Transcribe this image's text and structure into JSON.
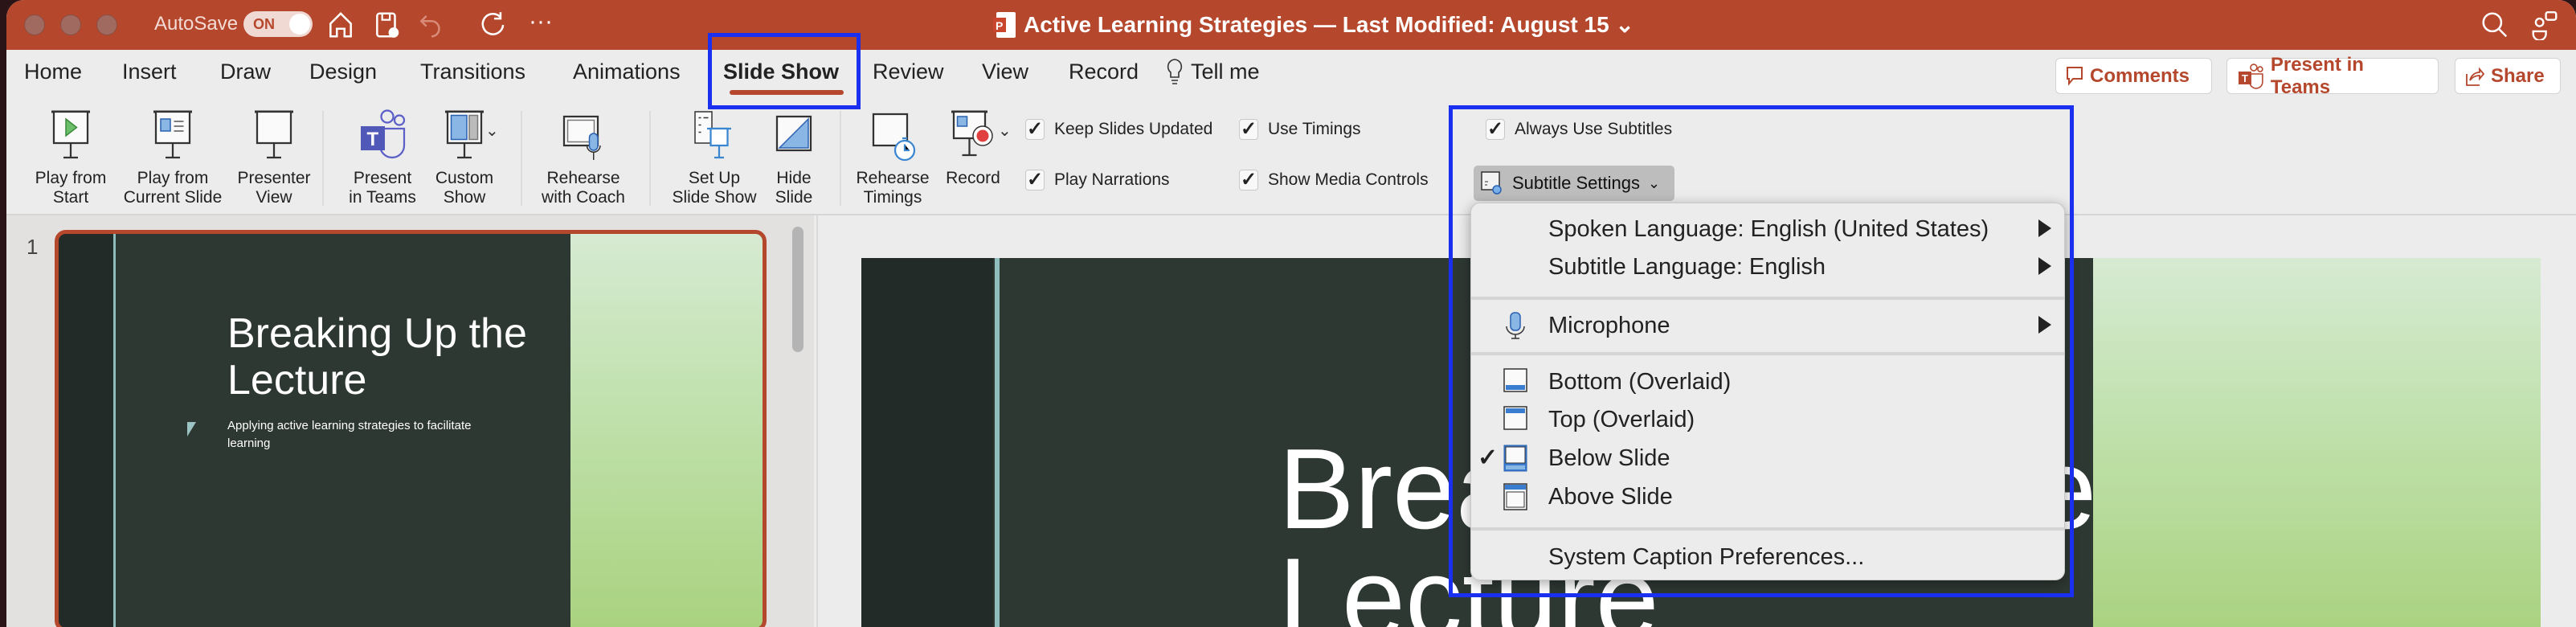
{
  "window": {
    "title": "Active Learning Strategies — Last Modified: August 15",
    "autosave_label": "AutoSave",
    "autosave_state": "ON"
  },
  "tabs": [
    {
      "label": "Home"
    },
    {
      "label": "Insert"
    },
    {
      "label": "Draw"
    },
    {
      "label": "Design"
    },
    {
      "label": "Transitions"
    },
    {
      "label": "Animations"
    },
    {
      "label": "Slide Show",
      "active": true
    },
    {
      "label": "Review"
    },
    {
      "label": "View"
    },
    {
      "label": "Record"
    },
    {
      "label": "Tell me"
    }
  ],
  "header_buttons": {
    "comments": "Comments",
    "present_teams": "Present in Teams",
    "share": "Share"
  },
  "ribbon": {
    "play_start": [
      "Play from",
      "Start"
    ],
    "play_current": [
      "Play from",
      "Current Slide"
    ],
    "presenter": [
      "Presenter",
      "View"
    ],
    "present_teams": [
      "Present",
      "in Teams"
    ],
    "custom_show": [
      "Custom",
      "Show"
    ],
    "rehearse_coach": [
      "Rehearse",
      "with Coach"
    ],
    "setup": [
      "Set Up",
      "Slide Show"
    ],
    "hide": [
      "Hide",
      "Slide"
    ],
    "rehearse_timings": [
      "Rehearse",
      "Timings"
    ],
    "record": "Record",
    "checkboxes": {
      "keep_updated": {
        "label": "Keep Slides Updated",
        "checked": true
      },
      "play_narrations": {
        "label": "Play Narrations",
        "checked": true
      },
      "use_timings": {
        "label": "Use Timings",
        "checked": true
      },
      "show_media": {
        "label": "Show Media Controls",
        "checked": true
      },
      "always_subtitles": {
        "label": "Always Use Subtitles",
        "checked": true
      }
    },
    "subtitle_settings": "Subtitle Settings"
  },
  "subtitle_menu": {
    "spoken": "Spoken Language: English (United States)",
    "subtitle_lang": "Subtitle Language: English",
    "microphone": "Microphone",
    "bottom": "Bottom (Overlaid)",
    "top": "Top (Overlaid)",
    "below": "Below Slide",
    "above": "Above Slide",
    "selected": "Below Slide",
    "system": "System Caption Preferences..."
  },
  "slides": {
    "number": "1",
    "title_line1": "Breaking Up the",
    "title_line2": "Lecture",
    "subtitle_line1": "Applying active learning strategies to facilitate",
    "subtitle_line2": "learning",
    "main_line1": "Breaking Up the",
    "main_line2": "Lecture"
  },
  "colors": {
    "accent": "#b5472d",
    "highlight": "#1a2ff0",
    "slide_dark": "#2e3833",
    "slide_teal": "#8fbcbc"
  }
}
